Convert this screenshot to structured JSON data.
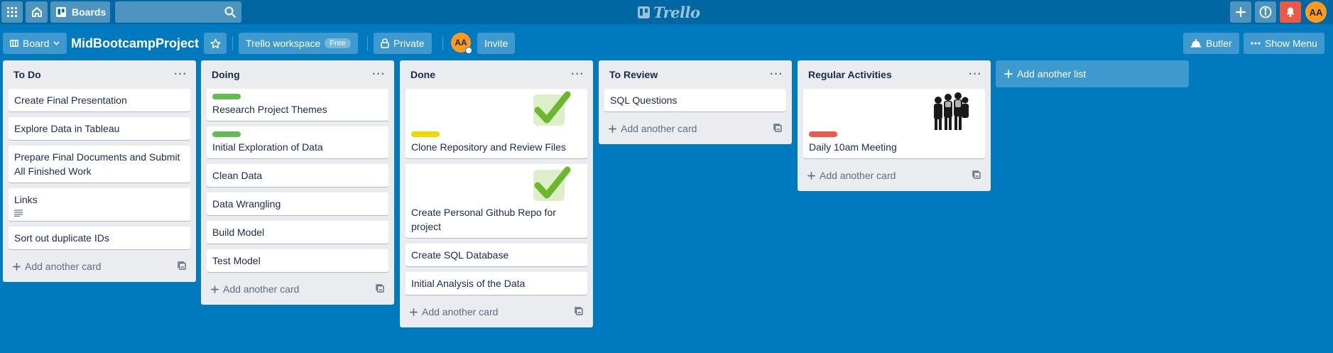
{
  "header": {
    "boards_label": "Boards",
    "search_placeholder": "",
    "logo_text": "Trello",
    "user_initials": "AA"
  },
  "board_header": {
    "view_label": "Board",
    "title": "MidBootcampProject",
    "workspace_label": "Trello workspace",
    "workspace_badge": "Free",
    "visibility_label": "Private",
    "member_initials": "AA",
    "invite_label": "Invite",
    "butler_label": "Butler",
    "show_menu_label": "Show Menu"
  },
  "lists": [
    {
      "title": "To Do",
      "cards": [
        {
          "title": "Create Final Presentation"
        },
        {
          "title": "Explore Data in Tableau"
        },
        {
          "title": "Prepare Final Documents and Submit All Finished Work"
        },
        {
          "title": "Links",
          "has_description": true
        },
        {
          "title": "Sort out duplicate IDs"
        }
      ],
      "add_card_label": "Add another card"
    },
    {
      "title": "Doing",
      "cards": [
        {
          "title": "Research Project Themes",
          "label_color": "#61bd4f"
        },
        {
          "title": "Initial Exploration of Data",
          "label_color": "#61bd4f"
        },
        {
          "title": "Clean Data"
        },
        {
          "title": "Data Wrangling"
        },
        {
          "title": "Build Model"
        },
        {
          "title": "Test Model"
        }
      ],
      "add_card_label": "Add another card"
    },
    {
      "title": "Done",
      "cards": [
        {
          "title": "Clone Repository and Review Files",
          "cover": "checkmark",
          "label_color": "#f2d600"
        },
        {
          "title": "Create Personal Github Repo for project",
          "cover": "checkmark"
        },
        {
          "title": "Create SQL Database"
        },
        {
          "title": "Initial Analysis of the Data"
        }
      ],
      "add_card_label": "Add another card"
    },
    {
      "title": "To Review",
      "cards": [
        {
          "title": "SQL Questions"
        }
      ],
      "add_card_label": "Add another card"
    },
    {
      "title": "Regular Activities",
      "cards": [
        {
          "title": "Daily 10am Meeting",
          "cover": "people-photo",
          "label_color": "#eb5a46"
        }
      ],
      "add_card_label": "Add another card"
    }
  ],
  "add_list_label": "Add another list",
  "colors": {
    "board_background": "#0079bf",
    "header_background": "#0067a3",
    "list_background": "#ebecf0",
    "avatar": "#ff991f",
    "notification_button": "#eb5a46"
  }
}
